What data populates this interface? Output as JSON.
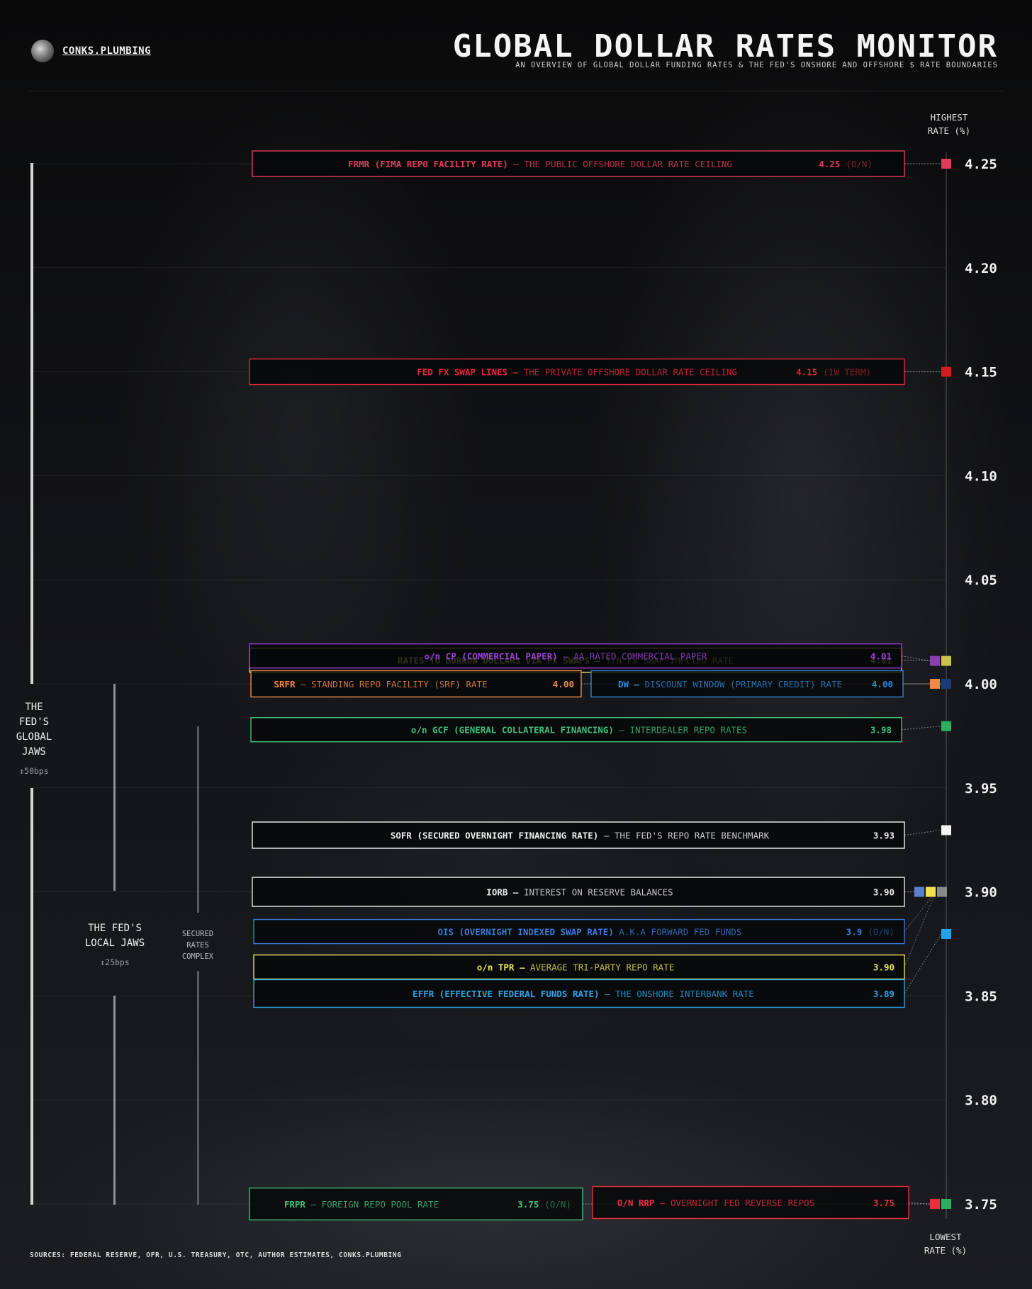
{
  "brand": {
    "name": "CONKS.PLUMBING"
  },
  "header": {
    "title": "GLOBAL DOLLAR RATES MONITOR",
    "subtitle": "AN OVERVIEW OF GLOBAL DOLLAR FUNDING RATES & THE FED'S ONSHORE AND OFFSHORE $ RATE BOUNDARIES"
  },
  "axis": {
    "top_caption_line1": "HIGHEST",
    "top_caption_line2": "RATE (%)",
    "bottom_caption_line1": "LOWEST",
    "bottom_caption_line2": "RATE (%)"
  },
  "jaws": {
    "global_line1": "THE",
    "global_line2": "FED'S",
    "global_line3": "GLOBAL",
    "global_line4": "JAWS",
    "global_width": "↕50bps",
    "local_line1": "THE FED'S",
    "local_line2": "LOCAL JAWS",
    "local_width": "↕25bps",
    "secured_line1": "SECURED",
    "secured_line2": "RATES",
    "secured_line3": "COMPLEX"
  },
  "footer": {
    "sources": "SOURCES: FEDERAL RESERVE, OFR, U.S. TREASURY, OTC, AUTHOR ESTIMATES, CONKS.PLUMBING"
  },
  "chart_data": {
    "type": "table",
    "y_ticks": [
      "4.25",
      "4.20",
      "4.15",
      "4.10",
      "4.05",
      "4.00",
      "3.95",
      "3.90",
      "3.85",
      "3.80",
      "3.75"
    ],
    "ylim": [
      3.75,
      4.25
    ],
    "ylabel": "RATE (%)",
    "grid": true,
    "rates": [
      {
        "key": "frmr",
        "bold": "FRMR (FIMA REPO FACILITY RATE)",
        "desc": " – THE PUBLIC OFFSHORE DOLLAR RATE CEILING",
        "value": 4.25,
        "value_text": "4.25",
        "tenor": "(O/N)",
        "color": "#e33a5c",
        "marker_colors": [
          "#e33a5c"
        ]
      },
      {
        "key": "swaplines",
        "bold": "FED FX SWAP LINES –",
        "desc": " THE PRIVATE OFFSHORE DOLLAR RATE CEILING",
        "value": 4.15,
        "value_text": "4.15",
        "tenor": "(1W TERM)",
        "color": "#e0283a",
        "marker_colors": [
          "#d41c1c"
        ]
      },
      {
        "key": "fxswap",
        "bold": "RATES TO BORROW DOLLARS VIA FX SWAPS –",
        "desc": " T/N FX SWAP IMPLIED RATE",
        "value": 4.01,
        "value_text": "4.01",
        "tenor": "",
        "color": "#e2e36a",
        "marker_colors": [
          "#c8c44a"
        ]
      },
      {
        "key": "cp",
        "bold": "o/n CP (COMMERCIAL PAPER)",
        "desc": " – AA RATED COMMERCIAL PAPER",
        "value": 4.01,
        "value_text": "4.01",
        "tenor": "",
        "color": "#9a3fd8",
        "marker_colors": [
          "#8a3fb0"
        ]
      },
      {
        "key": "srfr",
        "bold": "SRFR",
        "desc": " – STANDING REPO FACILITY (SRF) RATE",
        "value": 4.0,
        "value_text": "4.00",
        "tenor": "",
        "color": "#f08a48",
        "marker_colors": [
          "#f08a48"
        ]
      },
      {
        "key": "dw",
        "bold": "DW –",
        "desc": " DISCOUNT WINDOW (PRIMARY CREDIT) RATE",
        "value": 4.0,
        "value_text": "4.00",
        "tenor": "",
        "color": "#2f86d6",
        "marker_colors": [
          "#1b3a7a"
        ]
      },
      {
        "key": "gcf",
        "bold": "o/n GCF (GENERAL COLLATERAL FINANCING)",
        "desc": " – INTERDEALER REPO RATES",
        "value": 3.98,
        "value_text": "3.98",
        "tenor": "",
        "color": "#3ec07a",
        "marker_colors": [
          "#2fae62"
        ]
      },
      {
        "key": "sofr",
        "bold": "SOFR (SECURED OVERNIGHT FINANCING RATE)",
        "desc": " – THE FED'S REPO RATE BENCHMARK",
        "value": 3.93,
        "value_text": "3.93",
        "tenor": "",
        "color": "#f0f0f0",
        "marker_colors": [
          "#f4f4f4"
        ]
      },
      {
        "key": "iorb",
        "bold": "IORB –",
        "desc": " INTEREST ON RESERVE BALANCES",
        "value": 3.9,
        "value_text": "3.90",
        "tenor": "",
        "color": "#e6e6e6",
        "marker_colors": [
          "#5b7fd0",
          "#f2e24a",
          "#8a8a8a"
        ]
      },
      {
        "key": "ois",
        "bold": "OIS (OVERNIGHT INDEXED SWAP RATE)",
        "desc": " A.K.A FORWARD FED FUNDS",
        "value": 3.9,
        "value_text": "3.9",
        "tenor": "(O/N)",
        "color": "#3a7ad8",
        "marker_colors": []
      },
      {
        "key": "tpr",
        "bold": "o/n TPR –",
        "desc": " AVERAGE TRI-PARTY REPO RATE",
        "value": 3.9,
        "value_text": "3.90",
        "tenor": "",
        "color": "#e6e45a",
        "marker_colors": []
      },
      {
        "key": "effr",
        "bold": "EFFR (EFFECTIVE FEDERAL FUNDS RATE)",
        "desc": " – THE ONSHORE INTERBANK RATE",
        "value": 3.89,
        "value_text": "3.89",
        "tenor": "",
        "color": "#2aa6e6",
        "marker_colors": [
          "#22a4e8"
        ]
      },
      {
        "key": "frpr",
        "bold": "FRPR",
        "desc": " – FOREIGN REPO POOL RATE",
        "value": 3.75,
        "value_text": "3.75",
        "tenor": "(O/N)",
        "color": "#3ec07a",
        "marker_colors": []
      },
      {
        "key": "rrp",
        "bold": "O/N RRP",
        "desc": " – OVERNIGHT FED REVERSE REPOS",
        "value": 3.75,
        "value_text": "3.75",
        "tenor": "",
        "color": "#e8303e",
        "marker_colors": [
          "#e8303e",
          "#2fae62"
        ]
      }
    ]
  }
}
